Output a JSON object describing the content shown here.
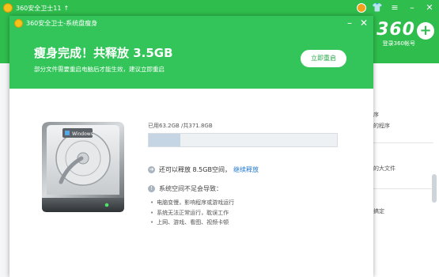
{
  "background": {
    "title": "360安全卫士11",
    "title_arrow": "↑",
    "brand": "360",
    "login_text": "登录360帐号",
    "right_panel": [
      "的程序",
      "资源的程序",
      "件",
      "空间的大文件",
      "一键搞定"
    ]
  },
  "modal": {
    "title": "360安全卫士-系统盘瘦身",
    "headline": "瘦身完成！共释放 3.5GB",
    "subline": "部分文件需要重启电脑后才能生效，建议立即重启",
    "restart_label": "立即重启",
    "disk_brand": "Windows"
  },
  "disk_usage": {
    "used_text": "已用63.2GB /共371.8GB",
    "used_gb": 63.2,
    "total_gb": 371.8
  },
  "release": {
    "text": "还可以释放 8.5GB空间，",
    "link": "继续释放"
  },
  "warning": {
    "title": "系统空间不足会导致：",
    "items": [
      "电脑变慢，影响程序或游戏运行",
      "系统无法正常运行，耽误工作",
      "上网、游戏、看图、视频卡顿"
    ]
  },
  "colors": {
    "header_green": "#33c55a",
    "link_blue": "#1f78d1"
  }
}
